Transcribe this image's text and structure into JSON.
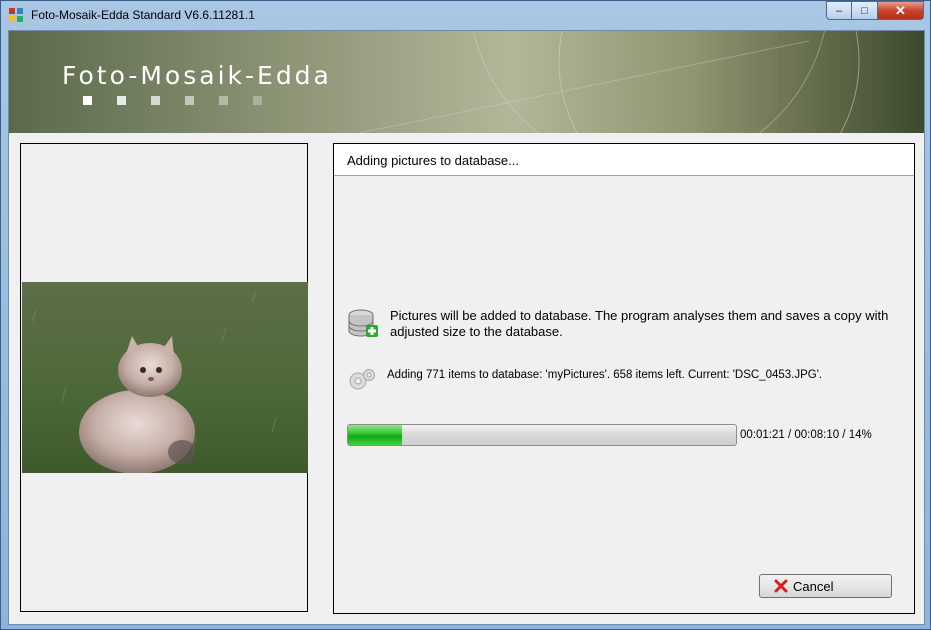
{
  "window": {
    "title": "Foto-Mosaik-Edda Standard V6.6.11281.1",
    "controls": {
      "minimize": "–",
      "maximize": "□",
      "close": "✕"
    }
  },
  "banner": {
    "logo": "Foto-Mosaik-Edda"
  },
  "left_panel": {
    "image": "cat-photo"
  },
  "right_panel": {
    "title": "Adding pictures to database...",
    "info_message": "Pictures will be added to database. The program analyses them and saves a copy with adjusted size to the database.",
    "status_message": "Adding 771 items to database: 'myPictures'. 658 items left. Current: 'DSC_0453.JPG'.",
    "progress": {
      "percent": 14,
      "text": "00:01:21 / 00:08:10 / 14%"
    },
    "cancel_label": "Cancel"
  },
  "colors": {
    "progress_green": "#2cc42c",
    "close_red": "#c7432b",
    "cancel_red": "#d81e1e"
  }
}
